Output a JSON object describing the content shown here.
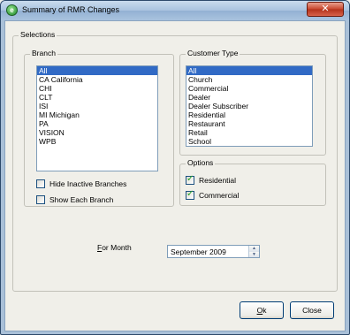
{
  "window": {
    "title": "Summary of RMR Changes",
    "close_glyph": "✕",
    "app_icon_glyph": "e"
  },
  "selections": {
    "label": "Selections"
  },
  "branch": {
    "label": "Branch",
    "items": [
      "All",
      "CA California",
      "CHI",
      "CLT",
      "ISI",
      "MI Michigan",
      "PA",
      "VISION",
      "WPB"
    ],
    "selected_index": 0
  },
  "customer_type": {
    "label": "Customer Type",
    "items": [
      "All",
      "Church",
      "Commercial",
      "Dealer",
      "Dealer Subscriber",
      "Residential",
      "Restaurant",
      "Retail",
      "School"
    ],
    "selected_index": 0
  },
  "branch_options": {
    "hide_inactive": {
      "label": "Hide Inactive Branches",
      "checked": false
    },
    "show_each": {
      "label": "Show Each Branch",
      "checked": false
    }
  },
  "options": {
    "label": "Options",
    "residential": {
      "label": "Residential",
      "checked": true
    },
    "commercial": {
      "label": "Commercial",
      "checked": true
    }
  },
  "for_month": {
    "label": "For Month",
    "value": "September 2009"
  },
  "buttons": {
    "ok": "Ok",
    "close": "Close"
  }
}
